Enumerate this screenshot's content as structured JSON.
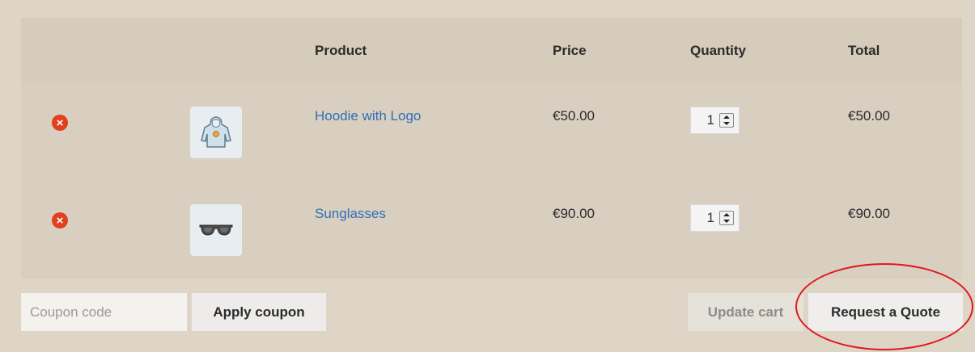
{
  "table": {
    "headers": {
      "product": "Product",
      "price": "Price",
      "quantity": "Quantity",
      "total": "Total"
    },
    "items": [
      {
        "remove_icon": "×",
        "name": "Hoodie with Logo",
        "price": "€50.00",
        "quantity": "1",
        "total": "€50.00",
        "thumbnail": "hoodie-thumbnail"
      },
      {
        "remove_icon": "×",
        "name": "Sunglasses",
        "price": "€90.00",
        "quantity": "1",
        "total": "€90.00",
        "thumbnail": "sunglasses-thumbnail"
      }
    ]
  },
  "actions": {
    "coupon_placeholder": "Coupon code",
    "apply_coupon_label": "Apply coupon",
    "update_cart_label": "Update cart",
    "request_quote_label": "Request a Quote"
  },
  "colors": {
    "page_bg": "#ded5c6",
    "link": "#2e6fb5",
    "remove": "#e1401e",
    "annotation": "#e0171f"
  }
}
